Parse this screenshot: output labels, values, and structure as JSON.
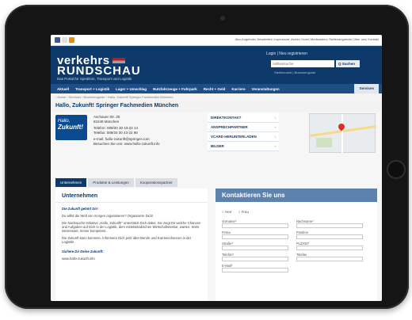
{
  "header": {
    "topnav": [
      "Abo-Angebote",
      "Newsletter",
      "Impressum",
      "Archiv",
      "Hotel",
      "Mediadaten",
      "Stellenangebote",
      "Über uns",
      "Kontakt"
    ],
    "logo_line1": "verkehrs",
    "logo_line2": "RUNDSCHAU",
    "tagline": "Das Portal für Spedition, Transport und Logistik",
    "login": "Login | Neu registrieren",
    "search_placeholder": "Volltextsuche",
    "search_button": "Q Suchen",
    "search_links": "Stellenmarkt | Branchenguide"
  },
  "nav": {
    "items": [
      "Aktuell",
      "Transport + Logistik",
      "Lager + Umschlag",
      "Nutzfahrzeuge + Fuhrpark",
      "Recht + Geld",
      "Karriere",
      "Veranstaltungen"
    ],
    "active": "Services"
  },
  "breadcrumb": "› Home › Services › Branchenguide › Hallo, Zukunft! Springer Fachmedien München",
  "page_title": "Hallo, Zukunft! Springer Fachmedien München",
  "company_logo": {
    "line1": "Hallo,",
    "line2": "Zukunft!"
  },
  "address": {
    "street": "Aschauer Str. 30",
    "city": "81549 München",
    "phone": "Telefon: 089/20 30 43-22 14",
    "fax": "Telefax: 089/20 30 43-22 98",
    "email": "e-mail: hallo-zukunft@springer.com",
    "web": "Besuchen Sie uns: www.hallo-zukunft.info"
  },
  "kontakt_links": [
    "DIREKTKONTAKT",
    "ANSPRECHPARTNER",
    "VCARD HERUNTERLADEN",
    "BILDER"
  ],
  "tabs": [
    "Unternehmen",
    "Produkte & Leistungen",
    "Kooperationspartner"
  ],
  "left": {
    "heading": "Unternehmen",
    "q1": "Die Zukunft gehört Dir!",
    "p1": "Du willst die Welt von morgen organisieren? Organisiere Dich!",
    "p2": "Die Nachwuchs-Initiative „Hallo, Zukunft!“ unterstützt Dich dabei. Sie zeigt Dir welche Chancen und Aufgaben auf Dich in der Logistik, dem mittelständischen Wirtschaftssektor, warten. Stets interessant. Immer kompetent.",
    "p3": "Die Zukunft kann kommen. Informiere Dich jetzt über Berufe und Karrierechancen in der Logistik!",
    "q2": "Sichere Dir Deine Zukunft:",
    "link": "www.hallo-zukunft.info"
  },
  "right": {
    "heading": "Kontaktieren Sie uns",
    "radios": [
      "Herr",
      "Frau"
    ],
    "fields": [
      [
        "Vorname*",
        "Nachname*"
      ],
      [
        "Firma",
        "Position"
      ],
      [
        "Straße*",
        "PLZ/Ort*"
      ],
      [
        "Telefon*",
        "Telefax"
      ],
      [
        "E-Mail*",
        ""
      ]
    ]
  },
  "colors": {
    "brand": "#0d3a6b",
    "nav": "#1f4e86",
    "accent": "#c4161c"
  }
}
